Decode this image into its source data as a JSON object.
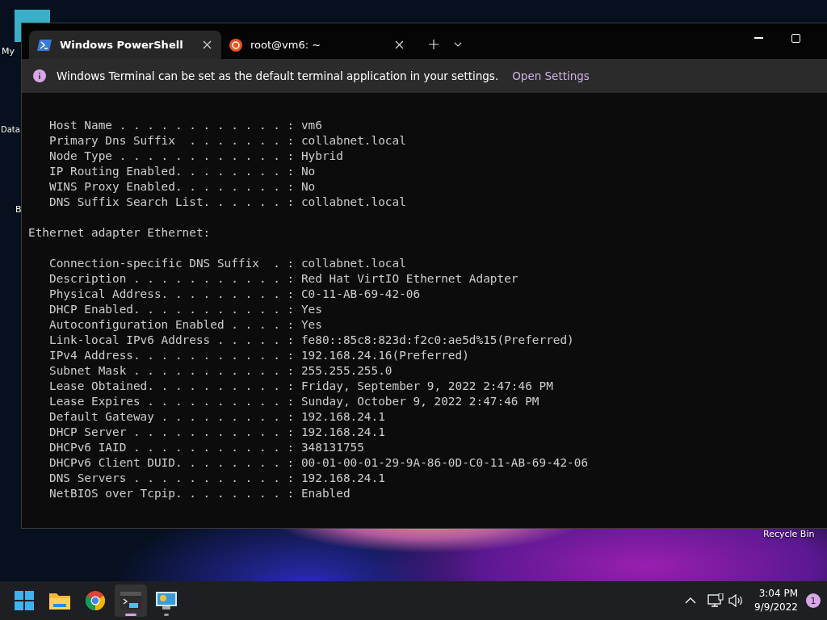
{
  "desktop_icons": [
    {
      "label": "My"
    },
    {
      "label": "Data"
    },
    {
      "label": "B"
    },
    {
      "label": "Recycle Bin"
    }
  ],
  "window": {
    "tabs": [
      {
        "title": "Windows PowerShell",
        "kind": "powershell",
        "selected": true
      },
      {
        "title": "root@vm6: ~",
        "kind": "ubuntu",
        "selected": false
      }
    ],
    "info_bar": {
      "message": "Windows Terminal can be set as the default terminal application in your settings.",
      "link": "Open Settings"
    },
    "terminal": {
      "sections": [
        {
          "lines": [
            "   Host Name . . . . . . . . . . . . : vm6",
            "   Primary Dns Suffix  . . . . . . . : collabnet.local",
            "   Node Type . . . . . . . . . . . . : Hybrid",
            "   IP Routing Enabled. . . . . . . . : No",
            "   WINS Proxy Enabled. . . . . . . . : No",
            "   DNS Suffix Search List. . . . . . : collabnet.local"
          ]
        },
        {
          "heading": "Ethernet adapter Ethernet:",
          "lines": [
            "   Connection-specific DNS Suffix  . : collabnet.local",
            "   Description . . . . . . . . . . . : Red Hat VirtIO Ethernet Adapter",
            "   Physical Address. . . . . . . . . : C0-11-AB-69-42-06",
            "   DHCP Enabled. . . . . . . . . . . : Yes",
            "   Autoconfiguration Enabled . . . . : Yes",
            "   Link-local IPv6 Address . . . . . : fe80::85c8:823d:f2c0:ae5d%15(Preferred)",
            "   IPv4 Address. . . . . . . . . . . : 192.168.24.16(Preferred)",
            "   Subnet Mask . . . . . . . . . . . : 255.255.255.0",
            "   Lease Obtained. . . . . . . . . . : Friday, September 9, 2022 2:47:46 PM",
            "   Lease Expires . . . . . . . . . . : Sunday, October 9, 2022 2:47:46 PM",
            "   Default Gateway . . . . . . . . . : 192.168.24.1",
            "   DHCP Server . . . . . . . . . . . : 192.168.24.1",
            "   DHCPv6 IAID . . . . . . . . . . . : 348131755",
            "   DHCPv6 Client DUID. . . . . . . . : 00-01-00-01-29-9A-86-0D-C0-11-AB-69-42-06",
            "   DNS Servers . . . . . . . . . . . : 192.168.24.1",
            "   NetBIOS over Tcpip. . . . . . . . : Enabled"
          ]
        }
      ]
    }
  },
  "taskbar": {
    "apps": [
      {
        "kind": "start",
        "selected": false,
        "running": false
      },
      {
        "kind": "explorer",
        "selected": false,
        "running": false
      },
      {
        "kind": "chrome",
        "selected": false,
        "running": false
      },
      {
        "kind": "terminal",
        "selected": true,
        "running": true
      },
      {
        "kind": "remote",
        "selected": false,
        "running": true
      }
    ],
    "time": "3:04 PM",
    "date": "9/9/2022",
    "notifications": "1"
  }
}
